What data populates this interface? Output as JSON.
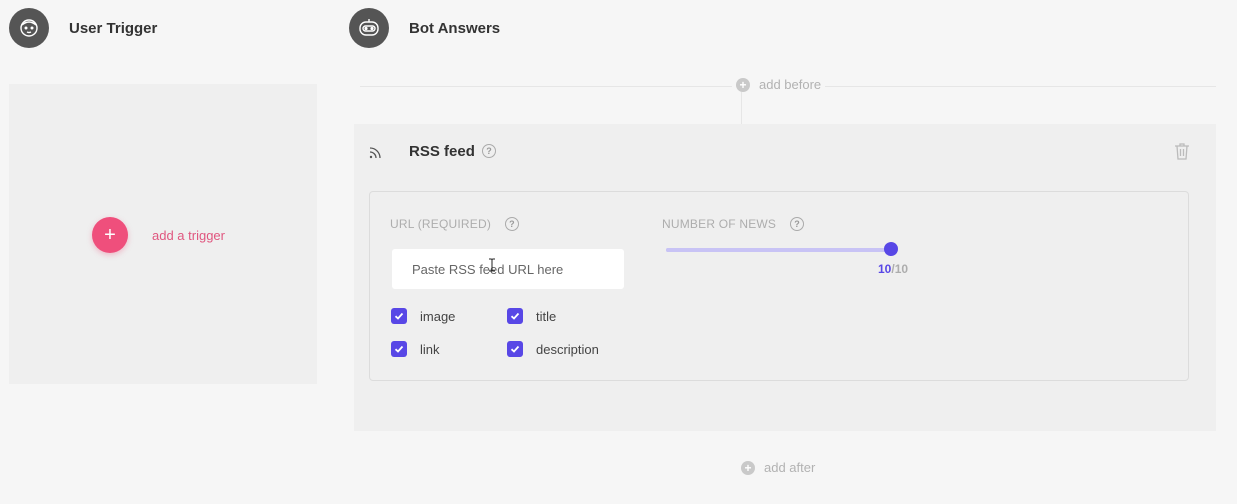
{
  "user_trigger": {
    "title": "User Trigger",
    "add_trigger_label": "add a trigger",
    "add_icon": "plus-icon"
  },
  "bot_answers": {
    "title": "Bot Answers",
    "add_before_label": "add before",
    "add_after_label": "add after"
  },
  "rss_card": {
    "title": "RSS feed",
    "icon": "rss-icon",
    "help_glyph": "?",
    "url": {
      "label": "URL (REQUIRED)",
      "placeholder": "Paste RSS feed URL here",
      "value": ""
    },
    "number_of_news": {
      "label": "NUMBER OF NEWS",
      "value": "10",
      "max_text": "/10",
      "fraction": 1.0
    },
    "checkboxes": [
      {
        "label": "image",
        "checked": true
      },
      {
        "label": "title",
        "checked": true
      },
      {
        "label": "link",
        "checked": true
      },
      {
        "label": "description",
        "checked": true
      }
    ]
  },
  "colors": {
    "accent": "#5847e6",
    "trigger_pink": "#ef4f7c",
    "avatar": "#555555"
  }
}
